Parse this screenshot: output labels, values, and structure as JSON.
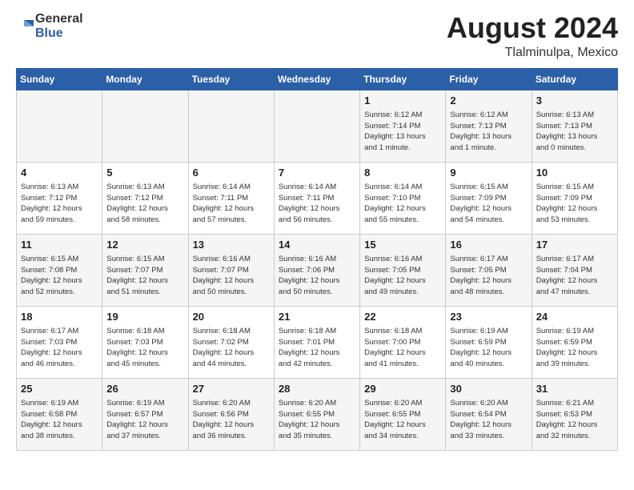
{
  "header": {
    "logo_general": "General",
    "logo_blue": "Blue",
    "month_year": "August 2024",
    "location": "Tlalminulpa, Mexico"
  },
  "weekdays": [
    "Sunday",
    "Monday",
    "Tuesday",
    "Wednesday",
    "Thursday",
    "Friday",
    "Saturday"
  ],
  "weeks": [
    [
      {
        "day": "",
        "info": ""
      },
      {
        "day": "",
        "info": ""
      },
      {
        "day": "",
        "info": ""
      },
      {
        "day": "",
        "info": ""
      },
      {
        "day": "1",
        "info": "Sunrise: 6:12 AM\nSunset: 7:14 PM\nDaylight: 13 hours\nand 1 minute."
      },
      {
        "day": "2",
        "info": "Sunrise: 6:12 AM\nSunset: 7:13 PM\nDaylight: 13 hours\nand 1 minute."
      },
      {
        "day": "3",
        "info": "Sunrise: 6:13 AM\nSunset: 7:13 PM\nDaylight: 13 hours\nand 0 minutes."
      }
    ],
    [
      {
        "day": "4",
        "info": "Sunrise: 6:13 AM\nSunset: 7:12 PM\nDaylight: 12 hours\nand 59 minutes."
      },
      {
        "day": "5",
        "info": "Sunrise: 6:13 AM\nSunset: 7:12 PM\nDaylight: 12 hours\nand 58 minutes."
      },
      {
        "day": "6",
        "info": "Sunrise: 6:14 AM\nSunset: 7:11 PM\nDaylight: 12 hours\nand 57 minutes."
      },
      {
        "day": "7",
        "info": "Sunrise: 6:14 AM\nSunset: 7:11 PM\nDaylight: 12 hours\nand 56 minutes."
      },
      {
        "day": "8",
        "info": "Sunrise: 6:14 AM\nSunset: 7:10 PM\nDaylight: 12 hours\nand 55 minutes."
      },
      {
        "day": "9",
        "info": "Sunrise: 6:15 AM\nSunset: 7:09 PM\nDaylight: 12 hours\nand 54 minutes."
      },
      {
        "day": "10",
        "info": "Sunrise: 6:15 AM\nSunset: 7:09 PM\nDaylight: 12 hours\nand 53 minutes."
      }
    ],
    [
      {
        "day": "11",
        "info": "Sunrise: 6:15 AM\nSunset: 7:08 PM\nDaylight: 12 hours\nand 52 minutes."
      },
      {
        "day": "12",
        "info": "Sunrise: 6:15 AM\nSunset: 7:07 PM\nDaylight: 12 hours\nand 51 minutes."
      },
      {
        "day": "13",
        "info": "Sunrise: 6:16 AM\nSunset: 7:07 PM\nDaylight: 12 hours\nand 50 minutes."
      },
      {
        "day": "14",
        "info": "Sunrise: 6:16 AM\nSunset: 7:06 PM\nDaylight: 12 hours\nand 50 minutes."
      },
      {
        "day": "15",
        "info": "Sunrise: 6:16 AM\nSunset: 7:05 PM\nDaylight: 12 hours\nand 49 minutes."
      },
      {
        "day": "16",
        "info": "Sunrise: 6:17 AM\nSunset: 7:05 PM\nDaylight: 12 hours\nand 48 minutes."
      },
      {
        "day": "17",
        "info": "Sunrise: 6:17 AM\nSunset: 7:04 PM\nDaylight: 12 hours\nand 47 minutes."
      }
    ],
    [
      {
        "day": "18",
        "info": "Sunrise: 6:17 AM\nSunset: 7:03 PM\nDaylight: 12 hours\nand 46 minutes."
      },
      {
        "day": "19",
        "info": "Sunrise: 6:18 AM\nSunset: 7:03 PM\nDaylight: 12 hours\nand 45 minutes."
      },
      {
        "day": "20",
        "info": "Sunrise: 6:18 AM\nSunset: 7:02 PM\nDaylight: 12 hours\nand 44 minutes."
      },
      {
        "day": "21",
        "info": "Sunrise: 6:18 AM\nSunset: 7:01 PM\nDaylight: 12 hours\nand 42 minutes."
      },
      {
        "day": "22",
        "info": "Sunrise: 6:18 AM\nSunset: 7:00 PM\nDaylight: 12 hours\nand 41 minutes."
      },
      {
        "day": "23",
        "info": "Sunrise: 6:19 AM\nSunset: 6:59 PM\nDaylight: 12 hours\nand 40 minutes."
      },
      {
        "day": "24",
        "info": "Sunrise: 6:19 AM\nSunset: 6:59 PM\nDaylight: 12 hours\nand 39 minutes."
      }
    ],
    [
      {
        "day": "25",
        "info": "Sunrise: 6:19 AM\nSunset: 6:58 PM\nDaylight: 12 hours\nand 38 minutes."
      },
      {
        "day": "26",
        "info": "Sunrise: 6:19 AM\nSunset: 6:57 PM\nDaylight: 12 hours\nand 37 minutes."
      },
      {
        "day": "27",
        "info": "Sunrise: 6:20 AM\nSunset: 6:56 PM\nDaylight: 12 hours\nand 36 minutes."
      },
      {
        "day": "28",
        "info": "Sunrise: 6:20 AM\nSunset: 6:55 PM\nDaylight: 12 hours\nand 35 minutes."
      },
      {
        "day": "29",
        "info": "Sunrise: 6:20 AM\nSunset: 6:55 PM\nDaylight: 12 hours\nand 34 minutes."
      },
      {
        "day": "30",
        "info": "Sunrise: 6:20 AM\nSunset: 6:54 PM\nDaylight: 12 hours\nand 33 minutes."
      },
      {
        "day": "31",
        "info": "Sunrise: 6:21 AM\nSunset: 6:53 PM\nDaylight: 12 hours\nand 32 minutes."
      }
    ]
  ]
}
